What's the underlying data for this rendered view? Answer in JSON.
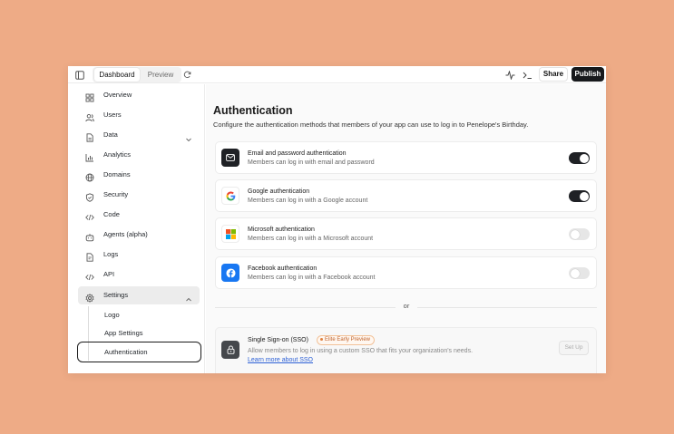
{
  "toolbar": {
    "tabs": [
      {
        "label": "Dashboard",
        "active": true
      },
      {
        "label": "Preview",
        "active": false
      }
    ],
    "share_label": "Share",
    "publish_label": "Publish",
    "icons": [
      "sidebar-toggle-icon",
      "refresh-icon",
      "activity-icon",
      "terminal-icon"
    ]
  },
  "sidebar": {
    "items": [
      {
        "label": "Overview",
        "icon": "grid-icon"
      },
      {
        "label": "Users",
        "icon": "users-icon"
      },
      {
        "label": "Data",
        "icon": "file-icon",
        "expandable": true
      },
      {
        "label": "Analytics",
        "icon": "chart-icon"
      },
      {
        "label": "Domains",
        "icon": "globe-icon"
      },
      {
        "label": "Security",
        "icon": "shield-icon"
      },
      {
        "label": "Code",
        "icon": "code-icon"
      },
      {
        "label": "Agents (alpha)",
        "icon": "bot-icon"
      },
      {
        "label": "Logs",
        "icon": "log-icon"
      },
      {
        "label": "API",
        "icon": "api-icon"
      },
      {
        "label": "Settings",
        "icon": "gear-icon",
        "expanded": true,
        "selected": true
      }
    ],
    "settings_children": [
      {
        "label": "Logo"
      },
      {
        "label": "App Settings"
      },
      {
        "label": "Authentication",
        "focused": true
      }
    ]
  },
  "main": {
    "title": "Authentication",
    "subtitle": "Configure the authentication methods that members of your app can use to log in to Penelope's Birthday.",
    "methods": [
      {
        "title": "Email and password authentication",
        "desc": "Members can log in with email and password",
        "enabled": true,
        "icon": "mail-icon"
      },
      {
        "title": "Google authentication",
        "desc": "Members can log in with a Google account",
        "enabled": true,
        "icon": "google-icon"
      },
      {
        "title": "Microsoft authentication",
        "desc": "Members can log in with a Microsoft account",
        "enabled": false,
        "icon": "microsoft-icon"
      },
      {
        "title": "Facebook authentication",
        "desc": "Members can log in with a Facebook account",
        "enabled": false,
        "icon": "facebook-icon"
      }
    ],
    "divider_text": "or",
    "sso": {
      "title": "Single Sign-on (SSO)",
      "badge": "Elite Early Preview",
      "desc": "Allow members to log in using a custom SSO that fits your organization's needs.",
      "link": "Learn more about SSO",
      "button": "Set Up",
      "icon": "lock-icon"
    }
  },
  "colors": {
    "background": "#eeab86",
    "toggle_on": "#1f2125",
    "toggle_off": "#e6e6e6",
    "publish": "#17191c",
    "link": "#2d61d6",
    "badge": "#c0622a"
  }
}
